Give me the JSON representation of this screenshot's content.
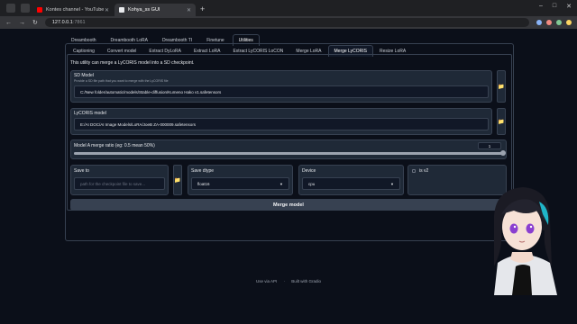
{
  "browser": {
    "tabs": [
      {
        "label": "Kontes channel - YouTube Studio",
        "favicon_color": "#ff0000",
        "active": false
      },
      {
        "label": "Kohya_ss GUI",
        "favicon_color": "#e8eaed",
        "active": true
      }
    ],
    "new_tab": "+",
    "url_host": "127.0.0.1",
    "url_port": ":7861",
    "window_controls": [
      "–",
      "□",
      "✕"
    ]
  },
  "main_tabs": [
    {
      "label": "Dreambooth",
      "active": false
    },
    {
      "label": "Dreambooth LoRA",
      "active": false
    },
    {
      "label": "Dreambooth TI",
      "active": false
    },
    {
      "label": "Finetune",
      "active": false
    },
    {
      "label": "Utilities",
      "active": true
    }
  ],
  "sub_tabs": [
    {
      "label": "Captioning",
      "active": false
    },
    {
      "label": "Convert model",
      "active": false
    },
    {
      "label": "Extract DyLoRA",
      "active": false
    },
    {
      "label": "Extract LoRA",
      "active": false
    },
    {
      "label": "Extract LyCORIS LoCON",
      "active": false
    },
    {
      "label": "Merge LoRA",
      "active": false
    },
    {
      "label": "Merge LyCORIS",
      "active": true
    },
    {
      "label": "Resize LoRA",
      "active": false
    }
  ],
  "description": "This utility can merge a LyCORIS model into a SD checkpoint.",
  "sd_model": {
    "label": "SD Model",
    "sublabel": "Provide a SD file path that you want to merge with the LyCORIS file",
    "value": "C:/New folder/automatic/models/Stable-diffusion/Kumeno Hako v1.safetensors"
  },
  "lycoris_model": {
    "label": "LyCORIS model",
    "value": "E:/AI DOC/AI Image Models/LoRA/JoeB ZA-000009.safetensors"
  },
  "merge_ratio": {
    "label": "Model A merge ratio (eg: 0.5 mean 50%)",
    "value": "1",
    "fraction": 1.0
  },
  "save_to": {
    "label": "Save to",
    "placeholder": "path for the checkpoint file to save..."
  },
  "save_dtype": {
    "label": "Save dtype",
    "value": "float16"
  },
  "device": {
    "label": "Device",
    "value": "cpu"
  },
  "is_v2": {
    "label": "is v2",
    "checked": false
  },
  "merge_button": "Merge model",
  "footer": {
    "api": "Use via API",
    "sep": "·",
    "gradio": "Built with Gradio"
  },
  "icons": {
    "folder": "folder-icon",
    "back": "back-arrow-icon",
    "forward": "forward-arrow-icon",
    "reload": "reload-icon"
  }
}
